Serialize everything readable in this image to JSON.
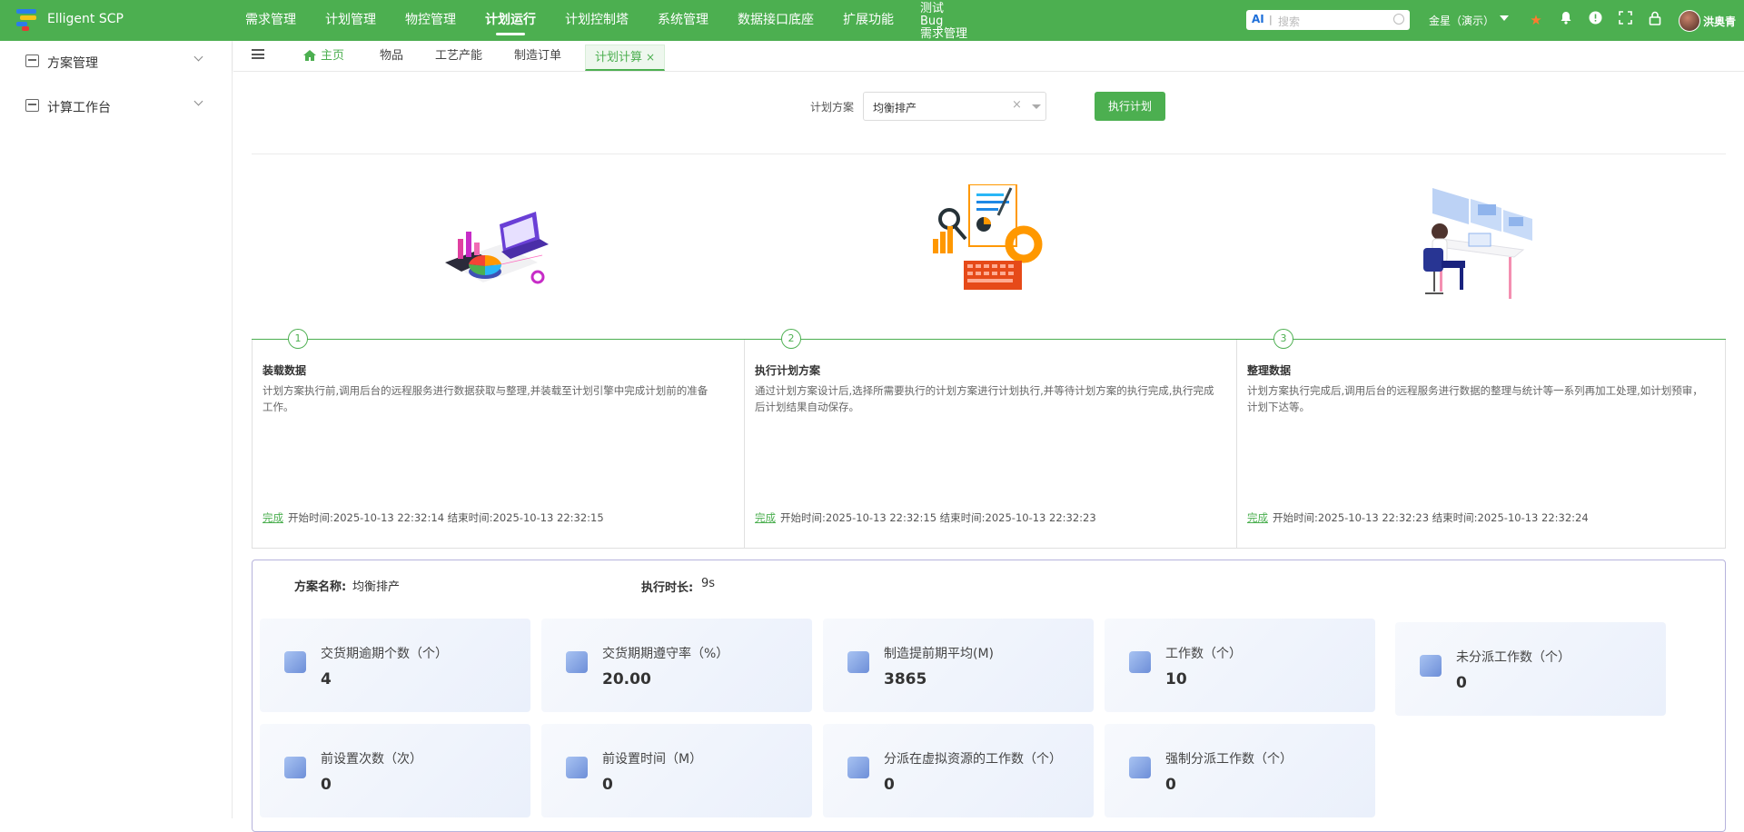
{
  "app": {
    "brand": "Elligent SCP"
  },
  "nav": [
    {
      "label": "需求管理"
    },
    {
      "label": "计划管理"
    },
    {
      "label": "物控管理"
    },
    {
      "label": "计划运行"
    },
    {
      "label": "计划控制塔"
    },
    {
      "label": "系统管理"
    },
    {
      "label": "数据接口底座"
    },
    {
      "label": "扩展功能"
    }
  ],
  "nav_stack": {
    "line1": "测试",
    "line2": "Bug",
    "line3": "需求管理"
  },
  "search": {
    "ai": "AI",
    "placeholder": "搜索"
  },
  "company": "金星（演示）",
  "user": {
    "name": "洪奥青"
  },
  "sidebar": {
    "items": [
      {
        "label": "方案管理"
      },
      {
        "label": "计算工作台"
      }
    ]
  },
  "tabs": [
    {
      "label": "主页"
    },
    {
      "label": "物品"
    },
    {
      "label": "工艺产能"
    },
    {
      "label": "制造订单"
    },
    {
      "label": "计划计算"
    }
  ],
  "plan": {
    "label": "计划方案",
    "value": "均衡排产",
    "run_button": "执行计划"
  },
  "steps": [
    {
      "num": "1",
      "title": "装载数据",
      "desc": "计划方案执行前,调用后台的远程服务进行数据获取与整理,并装载至计划引擎中完成计划前的准备工作。",
      "status": "完成",
      "time": "开始时间:2025-10-13 22:32:14 结束时间:2025-10-13 22:32:15"
    },
    {
      "num": "2",
      "title": "执行计划方案",
      "desc": "通过计划方案设计后,选择所需要执行的计划方案进行计划执行,并等待计划方案的执行完成,执行完成后计划结果自动保存。",
      "status": "完成",
      "time": "开始时间:2025-10-13 22:32:15 结束时间:2025-10-13 22:32:23"
    },
    {
      "num": "3",
      "title": "整理数据",
      "desc": "计划方案执行完成后,调用后台的远程服务进行数据的整理与统计等一系列再加工处理,如计划预审，计划下达等。",
      "status": "完成",
      "time": "开始时间:2025-10-13 22:32:23 结束时间:2025-10-13 22:32:24"
    }
  ],
  "summary": {
    "plan_name_label": "方案名称:",
    "plan_name_value": "均衡排产",
    "duration_label": "执行时长:",
    "duration_value": "9s",
    "cards": [
      {
        "title": "交货期逾期个数（个）",
        "value": "4"
      },
      {
        "title": "交货期期遵守率（%）",
        "value": "20.00"
      },
      {
        "title": "制造提前期平均(M)",
        "value": "3865"
      },
      {
        "title": "工作数（个）",
        "value": "10"
      },
      {
        "title": "未分派工作数（个）",
        "value": "0"
      },
      {
        "title": "前设置次数（次）",
        "value": "0"
      },
      {
        "title": "前设置时间（M）",
        "value": "0"
      },
      {
        "title": "分派在虚拟资源的工作数（个）",
        "value": "0"
      },
      {
        "title": "强制分派工作数（个）",
        "value": "0"
      }
    ]
  },
  "colors": {
    "primary": "#4caf50",
    "summary_border": "#b6b3dc"
  }
}
